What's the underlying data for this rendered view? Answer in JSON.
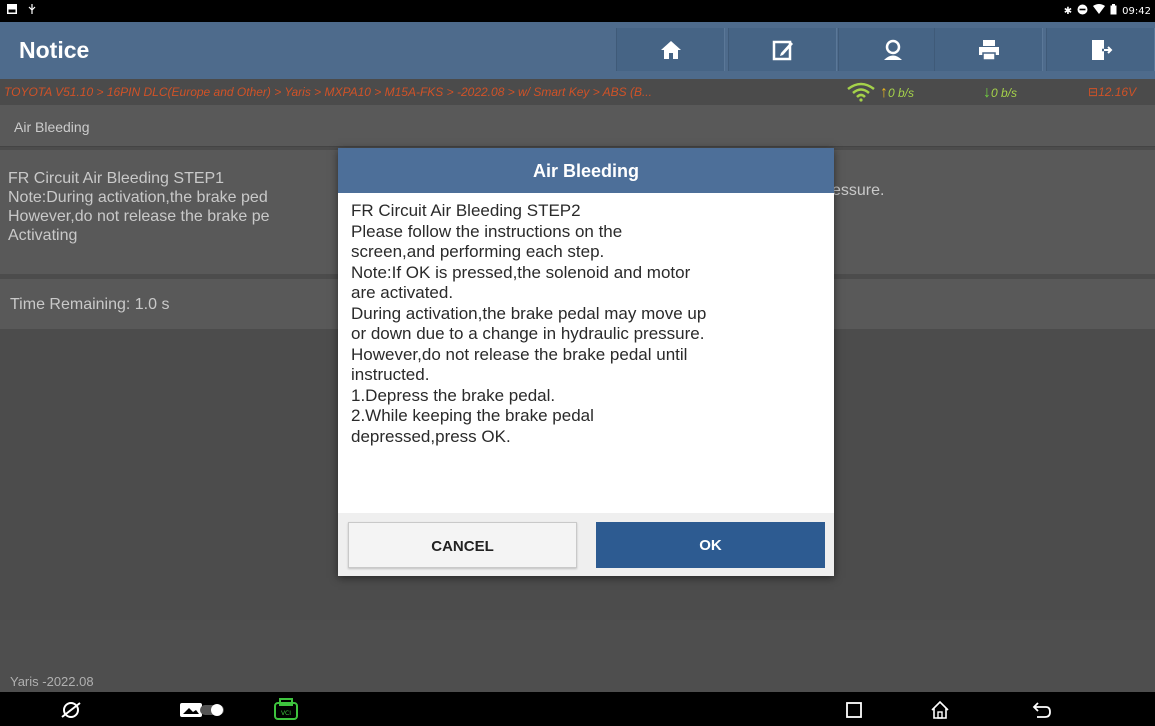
{
  "status_bar": {
    "time": "09:42",
    "icons": [
      "gallery-icon",
      "usb-icon",
      "bluetooth-icon",
      "dnd-icon",
      "wifi-icon",
      "battery-icon"
    ]
  },
  "header": {
    "title": "Notice",
    "buttons": [
      "home-icon",
      "edit-report-icon",
      "support-icon",
      "print-icon",
      "exit-icon"
    ]
  },
  "breadcrumb": {
    "path": "TOYOTA V51.10 > 16PIN DLC(Europe and Other) > Yaris > MXPA10 > M15A-FKS > -2022.08 > w/ Smart Key > ABS (B...",
    "upload": "0 b/s",
    "download": "0 b/s",
    "voltage": "12.16V"
  },
  "content": {
    "section_title": "Air Bleeding",
    "info_lines": [
      "FR Circuit Air Bleeding STEP1",
      "Note:During activation,the brake ped",
      "However,do not release the brake pe",
      "Activating"
    ],
    "info_partial_right": "essure.",
    "time_remaining": "Time Remaining: 1.0 s",
    "footer": "Yaris -2022.08"
  },
  "dialog": {
    "title": "Air Bleeding",
    "lines": [
      "FR Circuit Air Bleeding STEP2",
      "Please follow the instructions on the",
      "screen,and performing each step.",
      "Note:If OK is pressed,the solenoid and motor",
      "are activated.",
      "During activation,the brake pedal may move up",
      "or down due to a change in hydraulic pressure.",
      "However,do not release the brake pedal until",
      "instructed.",
      "1.Depress the brake pedal.",
      "2.While keeping the brake pedal",
      "depressed,press OK."
    ],
    "cancel_label": "CANCEL",
    "ok_label": "OK"
  },
  "colors": {
    "header": "#4e6b8c",
    "accent_button": "#2d5b91",
    "breadcrumb_text": "#d05227",
    "rate_text": "#a5d24a"
  }
}
